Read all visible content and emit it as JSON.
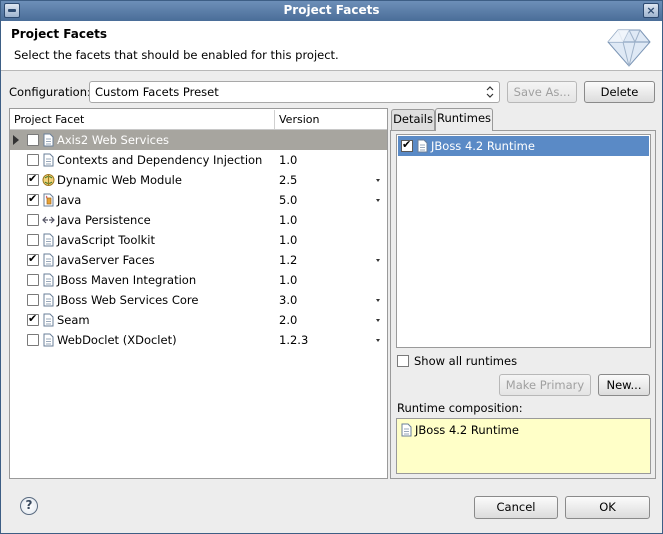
{
  "window": {
    "title": "Project Facets"
  },
  "banner": {
    "heading": "Project Facets",
    "description": "Select the facets that should be enabled for this project."
  },
  "configuration": {
    "label": "Configuration:",
    "value": "Custom Facets Preset",
    "save_as_label": "Save As...",
    "delete_label": "Delete"
  },
  "facets_table": {
    "columns": [
      "Project Facet",
      "Version"
    ],
    "rows": [
      {
        "name": "Axis2 Web Services",
        "version": "",
        "checked": false,
        "selected": true,
        "expandable": true,
        "has_dropdown": false,
        "icon": "expand-icon"
      },
      {
        "name": "Contexts and Dependency Injection",
        "version": "1.0",
        "checked": false,
        "selected": false,
        "has_dropdown": false,
        "icon": "page-icon"
      },
      {
        "name": "Dynamic Web Module",
        "version": "2.5",
        "checked": true,
        "selected": false,
        "has_dropdown": true,
        "icon": "web-module-icon"
      },
      {
        "name": "Java",
        "version": "5.0",
        "checked": true,
        "selected": false,
        "has_dropdown": true,
        "icon": "java-icon"
      },
      {
        "name": "Java Persistence",
        "version": "1.0",
        "checked": false,
        "selected": false,
        "has_dropdown": false,
        "icon": "persistence-icon"
      },
      {
        "name": "JavaScript Toolkit",
        "version": "1.0",
        "checked": false,
        "selected": false,
        "has_dropdown": false,
        "icon": "page-icon"
      },
      {
        "name": "JavaServer Faces",
        "version": "1.2",
        "checked": true,
        "selected": false,
        "has_dropdown": true,
        "icon": "page-icon"
      },
      {
        "name": "JBoss Maven Integration",
        "version": "1.0",
        "checked": false,
        "selected": false,
        "has_dropdown": false,
        "icon": "page-icon"
      },
      {
        "name": "JBoss Web Services Core",
        "version": "3.0",
        "checked": false,
        "selected": false,
        "has_dropdown": true,
        "icon": "page-icon"
      },
      {
        "name": "Seam",
        "version": "2.0",
        "checked": true,
        "selected": false,
        "has_dropdown": true,
        "icon": "page-icon"
      },
      {
        "name": "WebDoclet (XDoclet)",
        "version": "1.2.3",
        "checked": false,
        "selected": false,
        "has_dropdown": true,
        "icon": "page-icon"
      }
    ]
  },
  "tabs": [
    {
      "label": "Details",
      "active": false
    },
    {
      "label": "Runtimes",
      "active": true
    }
  ],
  "runtimes": {
    "items": [
      {
        "name": "JBoss 4.2 Runtime",
        "checked": true,
        "selected": true
      }
    ],
    "show_all_label": "Show all runtimes",
    "make_primary_label": "Make Primary",
    "new_label": "New...",
    "composition_label": "Runtime composition:",
    "composition_items": [
      "JBoss 4.2 Runtime"
    ]
  },
  "footer": {
    "help_label": "?",
    "cancel_label": "Cancel",
    "ok_label": "OK"
  },
  "colors": {
    "title_bar": "#4a6d98",
    "selection": "#5a8ac6",
    "facet_selected_row": "#a7a59f",
    "composition_bg": "#ffffc8"
  }
}
